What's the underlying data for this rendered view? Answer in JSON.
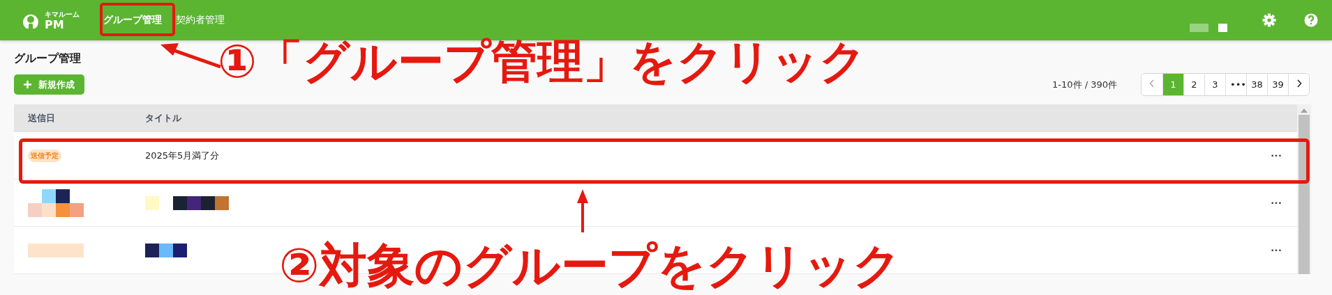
{
  "header": {
    "logo": {
      "caption": "キマルーム",
      "name": "PM"
    },
    "nav": [
      {
        "label": "グループ管理",
        "selected": true
      },
      {
        "label": "契約者管理",
        "selected": false
      }
    ]
  },
  "page_title": "グループ管理",
  "new_button": "新規作成",
  "pagination": {
    "summary": "1-10件 / 390件",
    "pages": [
      {
        "label": "1",
        "selected": true
      },
      {
        "label": "2",
        "selected": false
      },
      {
        "label": "3",
        "selected": false
      },
      {
        "label": "•••",
        "selected": false
      },
      {
        "label": "38",
        "selected": false
      },
      {
        "label": "39",
        "selected": false
      }
    ]
  },
  "table": {
    "columns": [
      "送信日",
      "タイトル"
    ],
    "rows": [
      {
        "kind": "text",
        "status": "送信予定",
        "title": "2025年5月満了分",
        "menu": "•••"
      },
      {
        "kind": "redacted",
        "menu": "•••"
      },
      {
        "kind": "redacted",
        "menu": "•••"
      }
    ]
  },
  "annotations": [
    {
      "text": "①「グループ管理」をクリック"
    },
    {
      "text": "②対象のグループをクリック"
    }
  ]
}
